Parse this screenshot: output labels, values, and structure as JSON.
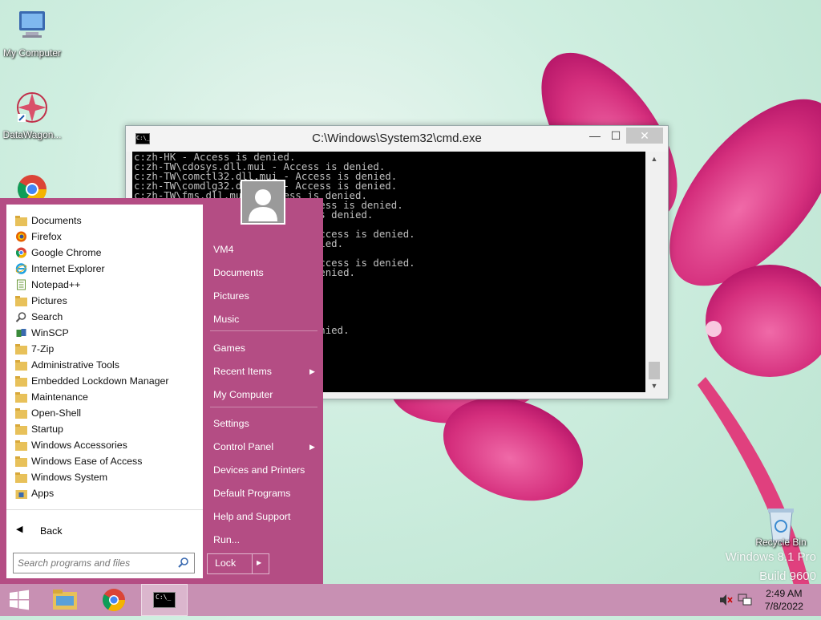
{
  "desktop": {
    "icons": [
      {
        "label": "My Computer"
      },
      {
        "label": "DataWagon..."
      },
      {
        "label": "Recycle Bin"
      }
    ],
    "watermark_line1": "Windows 8.1 Pro",
    "watermark_line2": "Build 9600"
  },
  "cmd_window": {
    "title": "C:\\Windows\\System32\\cmd.exe",
    "icon_text": "C:\\_",
    "lines": [
      "c:zh-HK - Access is denied.",
      "c:zh-TW\\cdosys.dll.mui - Access is denied.",
      "c:zh-TW\\comctl32.dll.mui - Access is denied.",
      "c:zh-TW\\comdlg32.dll.mui - Access is denied.",
      "c:zh-TW\\fms.dll.mui - Access is denied.",
      "c:           \\license.rtf - Access is denied.",
      "c:                   - Access is denied.",
      "c:           - Access is denied.",
      "c:           ~1\\license.rtf - Access is denied.",
      "c:           ~1 - Access is denied.",
      "c:           - Access is denied.",
      "c:           ~1\\license.rtf - Access is denied.",
      "c:           ES~1 - Access is denied.",
      "c:           - Access is denied.",
      "c:           - Access is denied.",
      "c:           - Access is denied.",
      "c:           - Access is denied.",
      "c:           - Access is denied.",
      "c:           mui - Access is denied.",
      "c:           - Access is denied.",
      "",
      "c:           ied.",
      ""
    ],
    "min_label": "—",
    "max_label": "☐",
    "close_label": "✕"
  },
  "start_menu": {
    "programs": [
      {
        "label": "Documents",
        "icon": "folder-icon"
      },
      {
        "label": "Firefox",
        "icon": "firefox-icon"
      },
      {
        "label": "Google Chrome",
        "icon": "chrome-icon"
      },
      {
        "label": "Internet Explorer",
        "icon": "ie-icon"
      },
      {
        "label": "Notepad++",
        "icon": "notepad-icon"
      },
      {
        "label": "Pictures",
        "icon": "folder-icon"
      },
      {
        "label": "Search",
        "icon": "search-icon"
      },
      {
        "label": "WinSCP",
        "icon": "winscp-icon"
      },
      {
        "label": "7-Zip",
        "icon": "folder-icon"
      },
      {
        "label": "Administrative Tools",
        "icon": "folder-icon"
      },
      {
        "label": "Embedded Lockdown Manager",
        "icon": "folder-icon"
      },
      {
        "label": "Maintenance",
        "icon": "folder-icon"
      },
      {
        "label": "Open-Shell",
        "icon": "folder-icon"
      },
      {
        "label": "Startup",
        "icon": "folder-icon"
      },
      {
        "label": "Windows Accessories",
        "icon": "folder-icon"
      },
      {
        "label": "Windows Ease of Access",
        "icon": "folder-icon"
      },
      {
        "label": "Windows System",
        "icon": "folder-icon"
      },
      {
        "label": "Apps",
        "icon": "apps-icon"
      }
    ],
    "back_label": "Back",
    "search_placeholder": "Search programs and files",
    "right_items": [
      {
        "label": "VM4",
        "submenu": false
      },
      {
        "label": "Documents",
        "submenu": false
      },
      {
        "label": "Pictures",
        "submenu": false
      },
      {
        "label": "Music",
        "submenu": false
      },
      {
        "label": "Games",
        "submenu": false
      },
      {
        "label": "Recent Items",
        "submenu": true
      },
      {
        "label": "My Computer",
        "submenu": false
      },
      {
        "label": "Settings",
        "submenu": false
      },
      {
        "label": "Control Panel",
        "submenu": true
      },
      {
        "label": "Devices and Printers",
        "submenu": false
      },
      {
        "label": "Default Programs",
        "submenu": false
      },
      {
        "label": "Help and Support",
        "submenu": false
      },
      {
        "label": "Run...",
        "submenu": false
      }
    ],
    "lock_label": "Lock"
  },
  "taskbar": {
    "time": "2:49 AM",
    "date": "7/8/2022",
    "cmd_icon_text": "C:\\_"
  },
  "colors": {
    "start_menu_bg": "#b44d84",
    "taskbar_bg": "#c890b3",
    "accent_pink": "#e0408a"
  }
}
